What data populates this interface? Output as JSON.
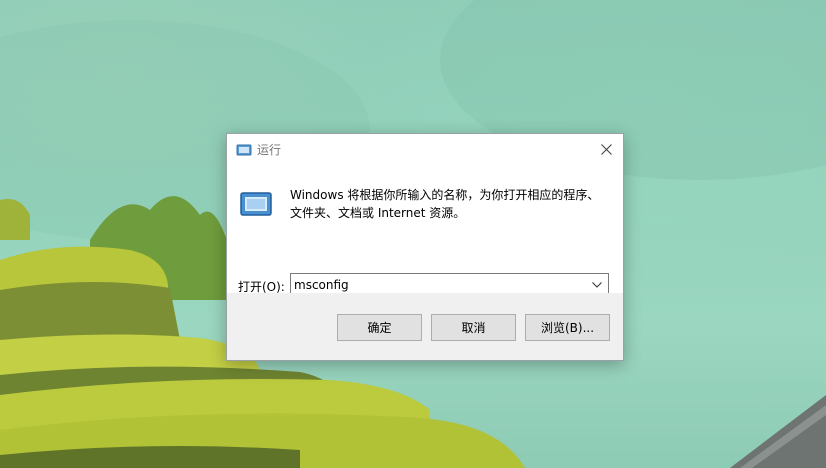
{
  "dialog": {
    "title": "运行",
    "description_line1": "Windows 将根据你所输入的名称，为你打开相应的程序、",
    "description_line2": "文件夹、文档或 Internet 资源。",
    "open_label": "打开(O):",
    "open_value": "msconfig",
    "buttons": {
      "ok": "确定",
      "cancel": "取消",
      "browse": "浏览(B)..."
    }
  },
  "icons": {
    "title": "run-app-icon",
    "large": "run-app-icon",
    "close": "close-icon",
    "dropdown": "chevron-down-icon"
  },
  "colors": {
    "wallpaper_sky": "#95d3bd",
    "terrace_green": "#b9c93a",
    "dialog_footer": "#f0f0f0",
    "button_face": "#e1e1e1"
  }
}
